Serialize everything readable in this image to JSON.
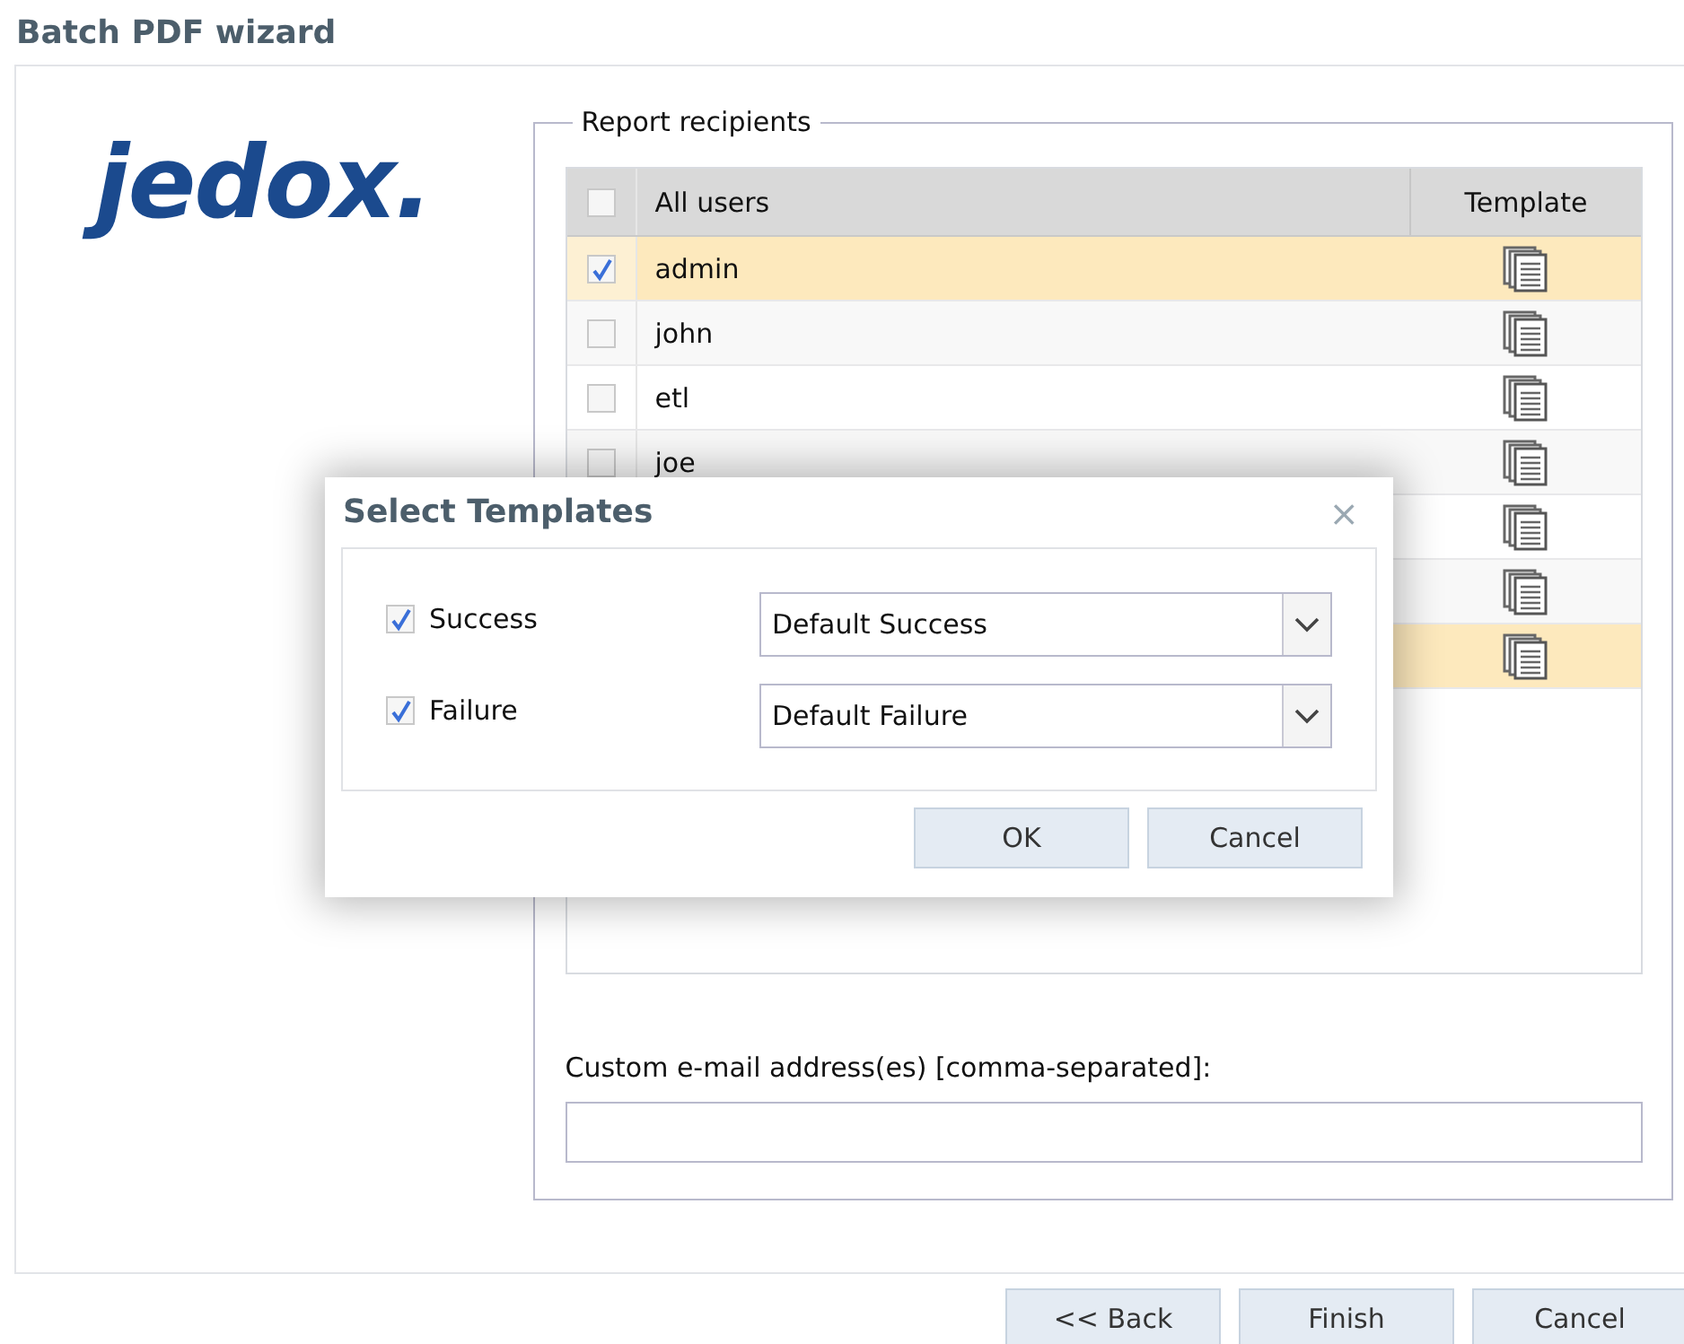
{
  "window": {
    "title": "Batch PDF wizard"
  },
  "logo": "jedox.",
  "recipients": {
    "legend": "Report recipients",
    "header": {
      "checked": false,
      "label": "All users",
      "template": "Template"
    },
    "rows": [
      {
        "name": "admin",
        "checked": true,
        "selected": true
      },
      {
        "name": "john",
        "checked": false,
        "selected": false
      },
      {
        "name": "etl",
        "checked": false,
        "selected": false
      },
      {
        "name": "joe",
        "checked": false,
        "selected": false
      },
      {
        "selected": false
      },
      {
        "selected": false
      },
      {
        "selected": true
      }
    ],
    "custom_label": "Custom e-mail address(es) [comma-separated]:"
  },
  "buttons": [
    "<< Back",
    "Finish",
    "Cancel"
  ],
  "dialog": {
    "title": "Select Templates",
    "close": "×",
    "items": [
      {
        "label": "Success",
        "checked": true,
        "value": "Default Success"
      },
      {
        "label": "Failure",
        "checked": true,
        "value": "Default Failure"
      }
    ],
    "buttons": [
      "OK",
      "Cancel"
    ]
  }
}
